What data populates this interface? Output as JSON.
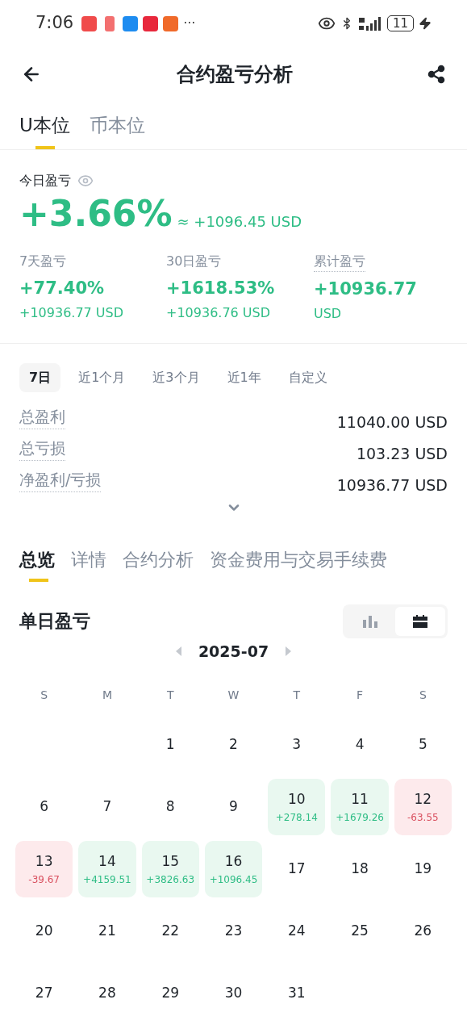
{
  "status_bar": {
    "time": "7:06",
    "more": "···",
    "battery": "11"
  },
  "header": {
    "title": "合约盈亏分析"
  },
  "base_tabs": [
    {
      "label": "U本位",
      "selected": true
    },
    {
      "label": "币本位",
      "selected": false
    }
  ],
  "today": {
    "label": "今日盈亏",
    "percent": "+3.66%",
    "approx": "≈ +1096.45 USD"
  },
  "stats": [
    {
      "label": "7天盈亏",
      "dotted": false,
      "value": "+77.40%",
      "sub": "+10936.77 USD"
    },
    {
      "label": "30日盈亏",
      "dotted": false,
      "value": "+1618.53%",
      "sub": "+10936.76 USD"
    },
    {
      "label": "累计盈亏",
      "dotted": true,
      "value": "+10936.77",
      "sub": "USD"
    }
  ],
  "periods": [
    {
      "label": "7日",
      "selected": true
    },
    {
      "label": "近1个月",
      "selected": false
    },
    {
      "label": "近3个月",
      "selected": false
    },
    {
      "label": "近1年",
      "selected": false
    },
    {
      "label": "自定义",
      "selected": false
    }
  ],
  "summary": [
    {
      "label": "总盈利",
      "value": "11040.00 USD"
    },
    {
      "label": "总亏损",
      "value": "103.23 USD"
    },
    {
      "label": "净盈利/亏损",
      "value": "10936.77 USD"
    }
  ],
  "section_tabs": [
    {
      "label": "总览",
      "selected": true
    },
    {
      "label": "详情",
      "selected": false
    },
    {
      "label": "合约分析",
      "selected": false
    },
    {
      "label": "资金费用与交易手续费",
      "selected": false
    }
  ],
  "daily": {
    "title": "单日盈亏",
    "views": [
      {
        "kind": "bar",
        "selected": false
      },
      {
        "kind": "calendar",
        "selected": true
      }
    ],
    "month": "2025-07",
    "weekdays": [
      "S",
      "M",
      "T",
      "W",
      "T",
      "F",
      "S"
    ],
    "days": [
      {
        "kind": "blank"
      },
      {
        "kind": "blank"
      },
      {
        "kind": "plain",
        "day": "1"
      },
      {
        "kind": "plain",
        "day": "2"
      },
      {
        "kind": "plain",
        "day": "3"
      },
      {
        "kind": "plain",
        "day": "4"
      },
      {
        "kind": "plain",
        "day": "5"
      },
      {
        "kind": "plain",
        "day": "6"
      },
      {
        "kind": "plain",
        "day": "7"
      },
      {
        "kind": "plain",
        "day": "8"
      },
      {
        "kind": "plain",
        "day": "9"
      },
      {
        "kind": "profit",
        "day": "10",
        "pnl": "+278.14"
      },
      {
        "kind": "profit",
        "day": "11",
        "pnl": "+1679.26"
      },
      {
        "kind": "loss",
        "day": "12",
        "pnl": "-63.55"
      },
      {
        "kind": "loss",
        "day": "13",
        "pnl": "-39.67"
      },
      {
        "kind": "profit",
        "day": "14",
        "pnl": "+4159.51"
      },
      {
        "kind": "profit",
        "day": "15",
        "pnl": "+3826.63"
      },
      {
        "kind": "profit",
        "day": "16",
        "pnl": "+1096.45"
      },
      {
        "kind": "plain",
        "day": "17"
      },
      {
        "kind": "plain",
        "day": "18"
      },
      {
        "kind": "plain",
        "day": "19"
      },
      {
        "kind": "plain",
        "day": "20"
      },
      {
        "kind": "plain",
        "day": "21"
      },
      {
        "kind": "plain",
        "day": "22"
      },
      {
        "kind": "plain",
        "day": "23"
      },
      {
        "kind": "plain",
        "day": "24"
      },
      {
        "kind": "plain",
        "day": "25"
      },
      {
        "kind": "plain",
        "day": "26"
      },
      {
        "kind": "plain",
        "day": "27"
      },
      {
        "kind": "plain",
        "day": "28"
      },
      {
        "kind": "plain",
        "day": "29"
      },
      {
        "kind": "plain",
        "day": "30"
      },
      {
        "kind": "plain",
        "day": "31"
      }
    ]
  }
}
